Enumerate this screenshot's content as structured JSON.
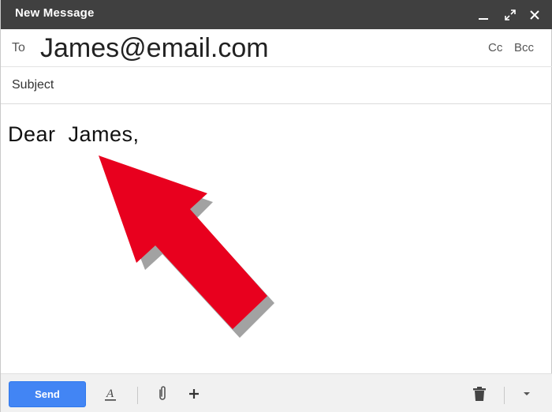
{
  "window": {
    "title": "New Message",
    "controls": [
      "minimize-icon",
      "popout-icon",
      "close-icon"
    ]
  },
  "recipients": {
    "to_label": "To",
    "to_value": "James@email.com",
    "cc_label": "Cc",
    "bcc_label": "Bcc"
  },
  "subject": {
    "placeholder": "Subject",
    "value": ""
  },
  "body": {
    "text": "Dear  James,"
  },
  "toolbar": {
    "send_label": "Send",
    "icons": [
      "formatting-icon",
      "attach-icon",
      "insert-more-icon",
      "trash-icon",
      "more-options-icon"
    ]
  },
  "colors": {
    "titlebar": "#404040",
    "send_button": "#4285f4",
    "arrow": "#e8001e"
  }
}
